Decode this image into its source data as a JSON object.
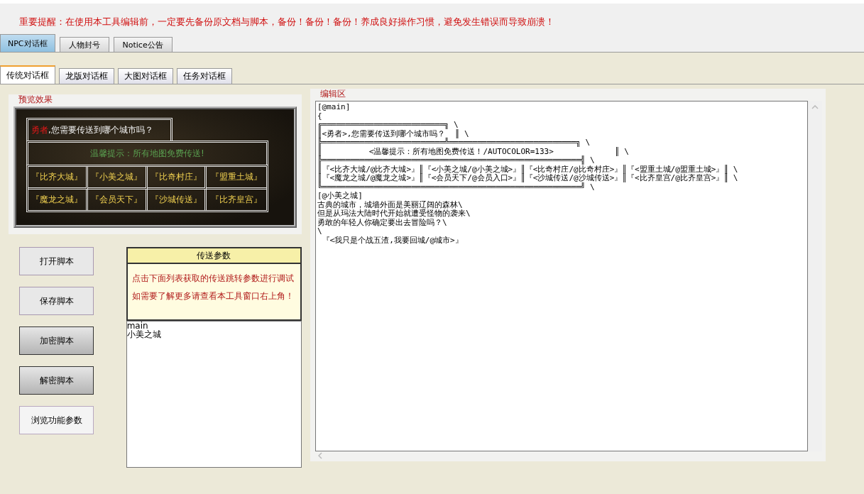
{
  "warning": "重要提醒：在使用本工具编辑前，一定要先备份原文档与脚本，备份！备份！备份！养成良好操作习惯，避免发生错误而导致崩溃！",
  "main_tabs": [
    {
      "label": "NPC对话框",
      "selected": true
    },
    {
      "label": "人物封号",
      "selected": false
    },
    {
      "label": "Notice公告",
      "selected": false
    }
  ],
  "sub_tabs": [
    {
      "label": "传统对话框",
      "selected": true
    },
    {
      "label": "龙版对话框",
      "selected": false
    },
    {
      "label": "大图对话框",
      "selected": false
    },
    {
      "label": "任务对话框",
      "selected": false
    }
  ],
  "preview": {
    "title": "预览效果",
    "hero": "勇者",
    "question": ",您需要传送到哪个城市吗？",
    "hint": "温馨提示：所有地图免费传送!",
    "cities": [
      "『比齐大城』",
      "『小美之城』",
      "『比奇村庄』",
      "『盟重土城』",
      "『魔龙之城』",
      "『会员天下』",
      "『沙城传送』",
      "『比齐皇宫』"
    ]
  },
  "buttons": [
    {
      "label": "打开脚本",
      "kind": "flat"
    },
    {
      "label": "保存脚本",
      "kind": "flat"
    },
    {
      "label": "加密脚本",
      "kind": "raised"
    },
    {
      "label": "解密脚本",
      "kind": "raised"
    },
    {
      "label": "浏览功能参数",
      "kind": "light"
    }
  ],
  "params": {
    "title": "传送参数",
    "notes": [
      "点击下面列表获取的传送跳转参数进行调试",
      "如需要了解更多请查看本工具窗口右上角！"
    ],
    "items": [
      "main",
      "小美之城"
    ]
  },
  "editor": {
    "title": "编辑区",
    "lines": [
      "[@main]",
      "{",
      "╔══════════════════════════╗ \\",
      "║<勇者>,您需要传送到哪个城市吗？  ║ \\",
      "╠══════════════════════════╩═══════════════════════════╗ \\",
      "║          <温馨提示：所有地图免费传送！/AUTOCOLOR=133>             ║ \\",
      "╠═══════════════════════════════════════════════════════╣ \\",
      "║『<比齐大城/@比齐大城>』║『<小美之城/@小美之城>』║『<比奇村庄/@比奇村庄>』║『<盟重土城/@盟重土城>』║ \\",
      "║『<魔龙之城/@魔龙之城>』║『<会员天下/@会员入口>』║『<沙城传送/@沙城传送>』║『<比齐皇宫/@比齐皇宫>』║ \\",
      "╚═══════════════════════════════════════════════════════╝ \\",
      "[@小美之城]",
      "古典的城市，城墙外面是美丽辽阔的森林\\",
      "但是从玛法大陆时代开始就遭受怪物的袭来\\",
      "勇敢的年轻人你确定要出去冒险吗？\\",
      "\\",
      " 『<我只是个战五渣,我要回城/@城市>』"
    ]
  }
}
